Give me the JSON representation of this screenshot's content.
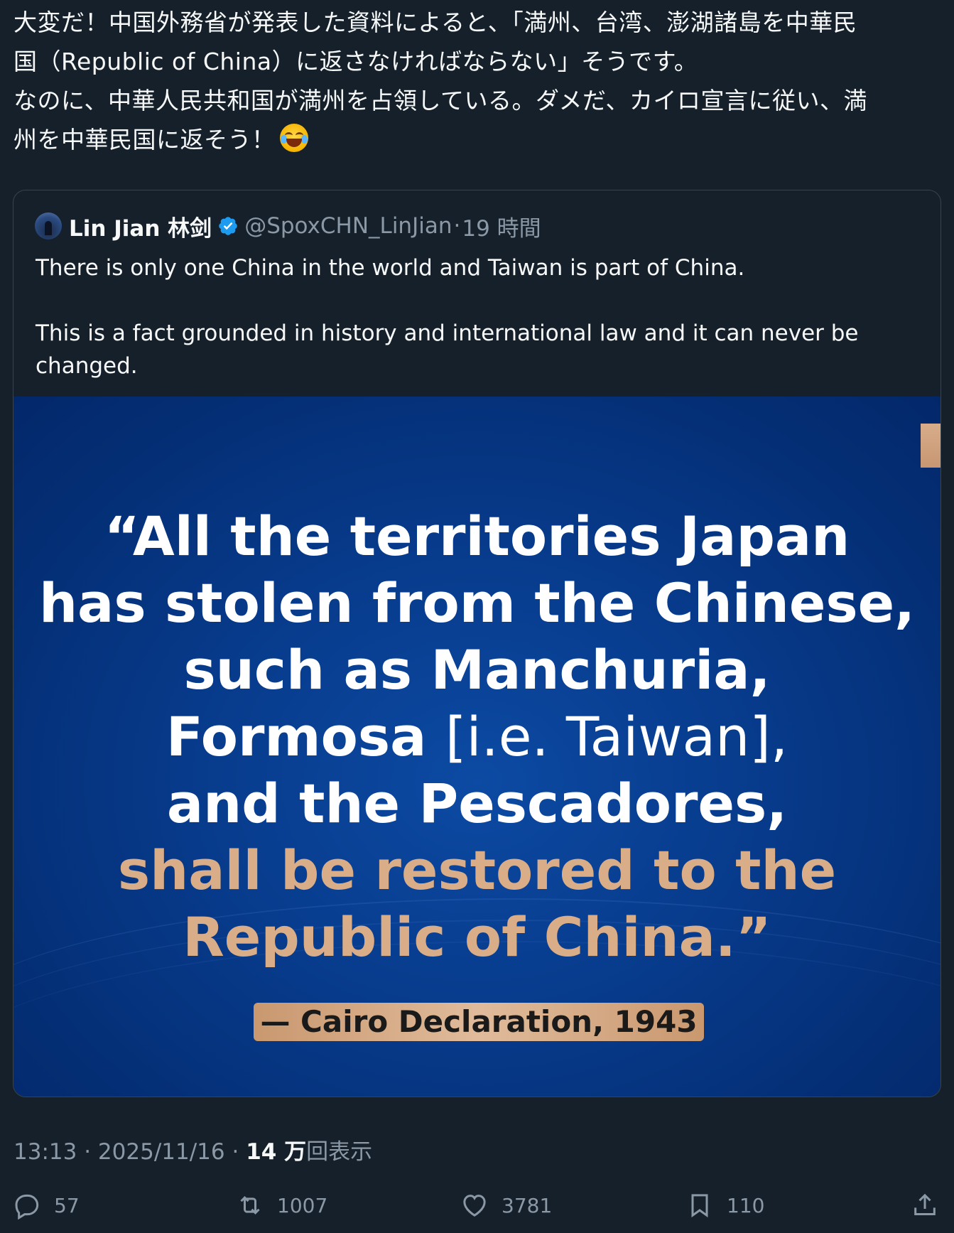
{
  "post": {
    "lines": [
      "大変だ！中国外務省が発表した資料によると、「満州、台湾、澎湖諸島を中華民",
      "国（Republic of China）に返さなければならない」そうです。",
      "なのに、中華人民共和国が満州を占領している。ダメだ、カイロ宣言に従い、満",
      "州を中華民国に返そう！"
    ],
    "emoji": "face-with-tears-of-joy"
  },
  "quoted": {
    "display_name": "Lin Jian 林剑",
    "handle": "@SpoxCHN_LinJian",
    "separator": "·",
    "time": "19 時間",
    "body": [
      "There is only one China in the world and Taiwan is part of China.",
      "This is a fact grounded in history and international law and it can never be changed."
    ],
    "image": {
      "quote_lines": [
        "“All the territories Japan",
        "has stolen from the Chinese,",
        "such as Manchuria,",
        "Formosa",
        "[i.e. Taiwan],",
        "and the Pescadores,",
        "shall be restored to the",
        "Republic of China.”"
      ],
      "attribution": "— Cairo Declaration, 1943",
      "colors": {
        "background": "#073a8a",
        "highlight": "#d8ad88",
        "badge": "#e0bb9b"
      }
    }
  },
  "meta": {
    "time": "13:13",
    "sep1": "·",
    "date": "2025/11/16",
    "sep2": "·",
    "views_count": "14 万",
    "views_label": "回表示"
  },
  "actions": {
    "replies": "57",
    "reposts": "1007",
    "likes": "3781",
    "bookmarks": "110"
  }
}
